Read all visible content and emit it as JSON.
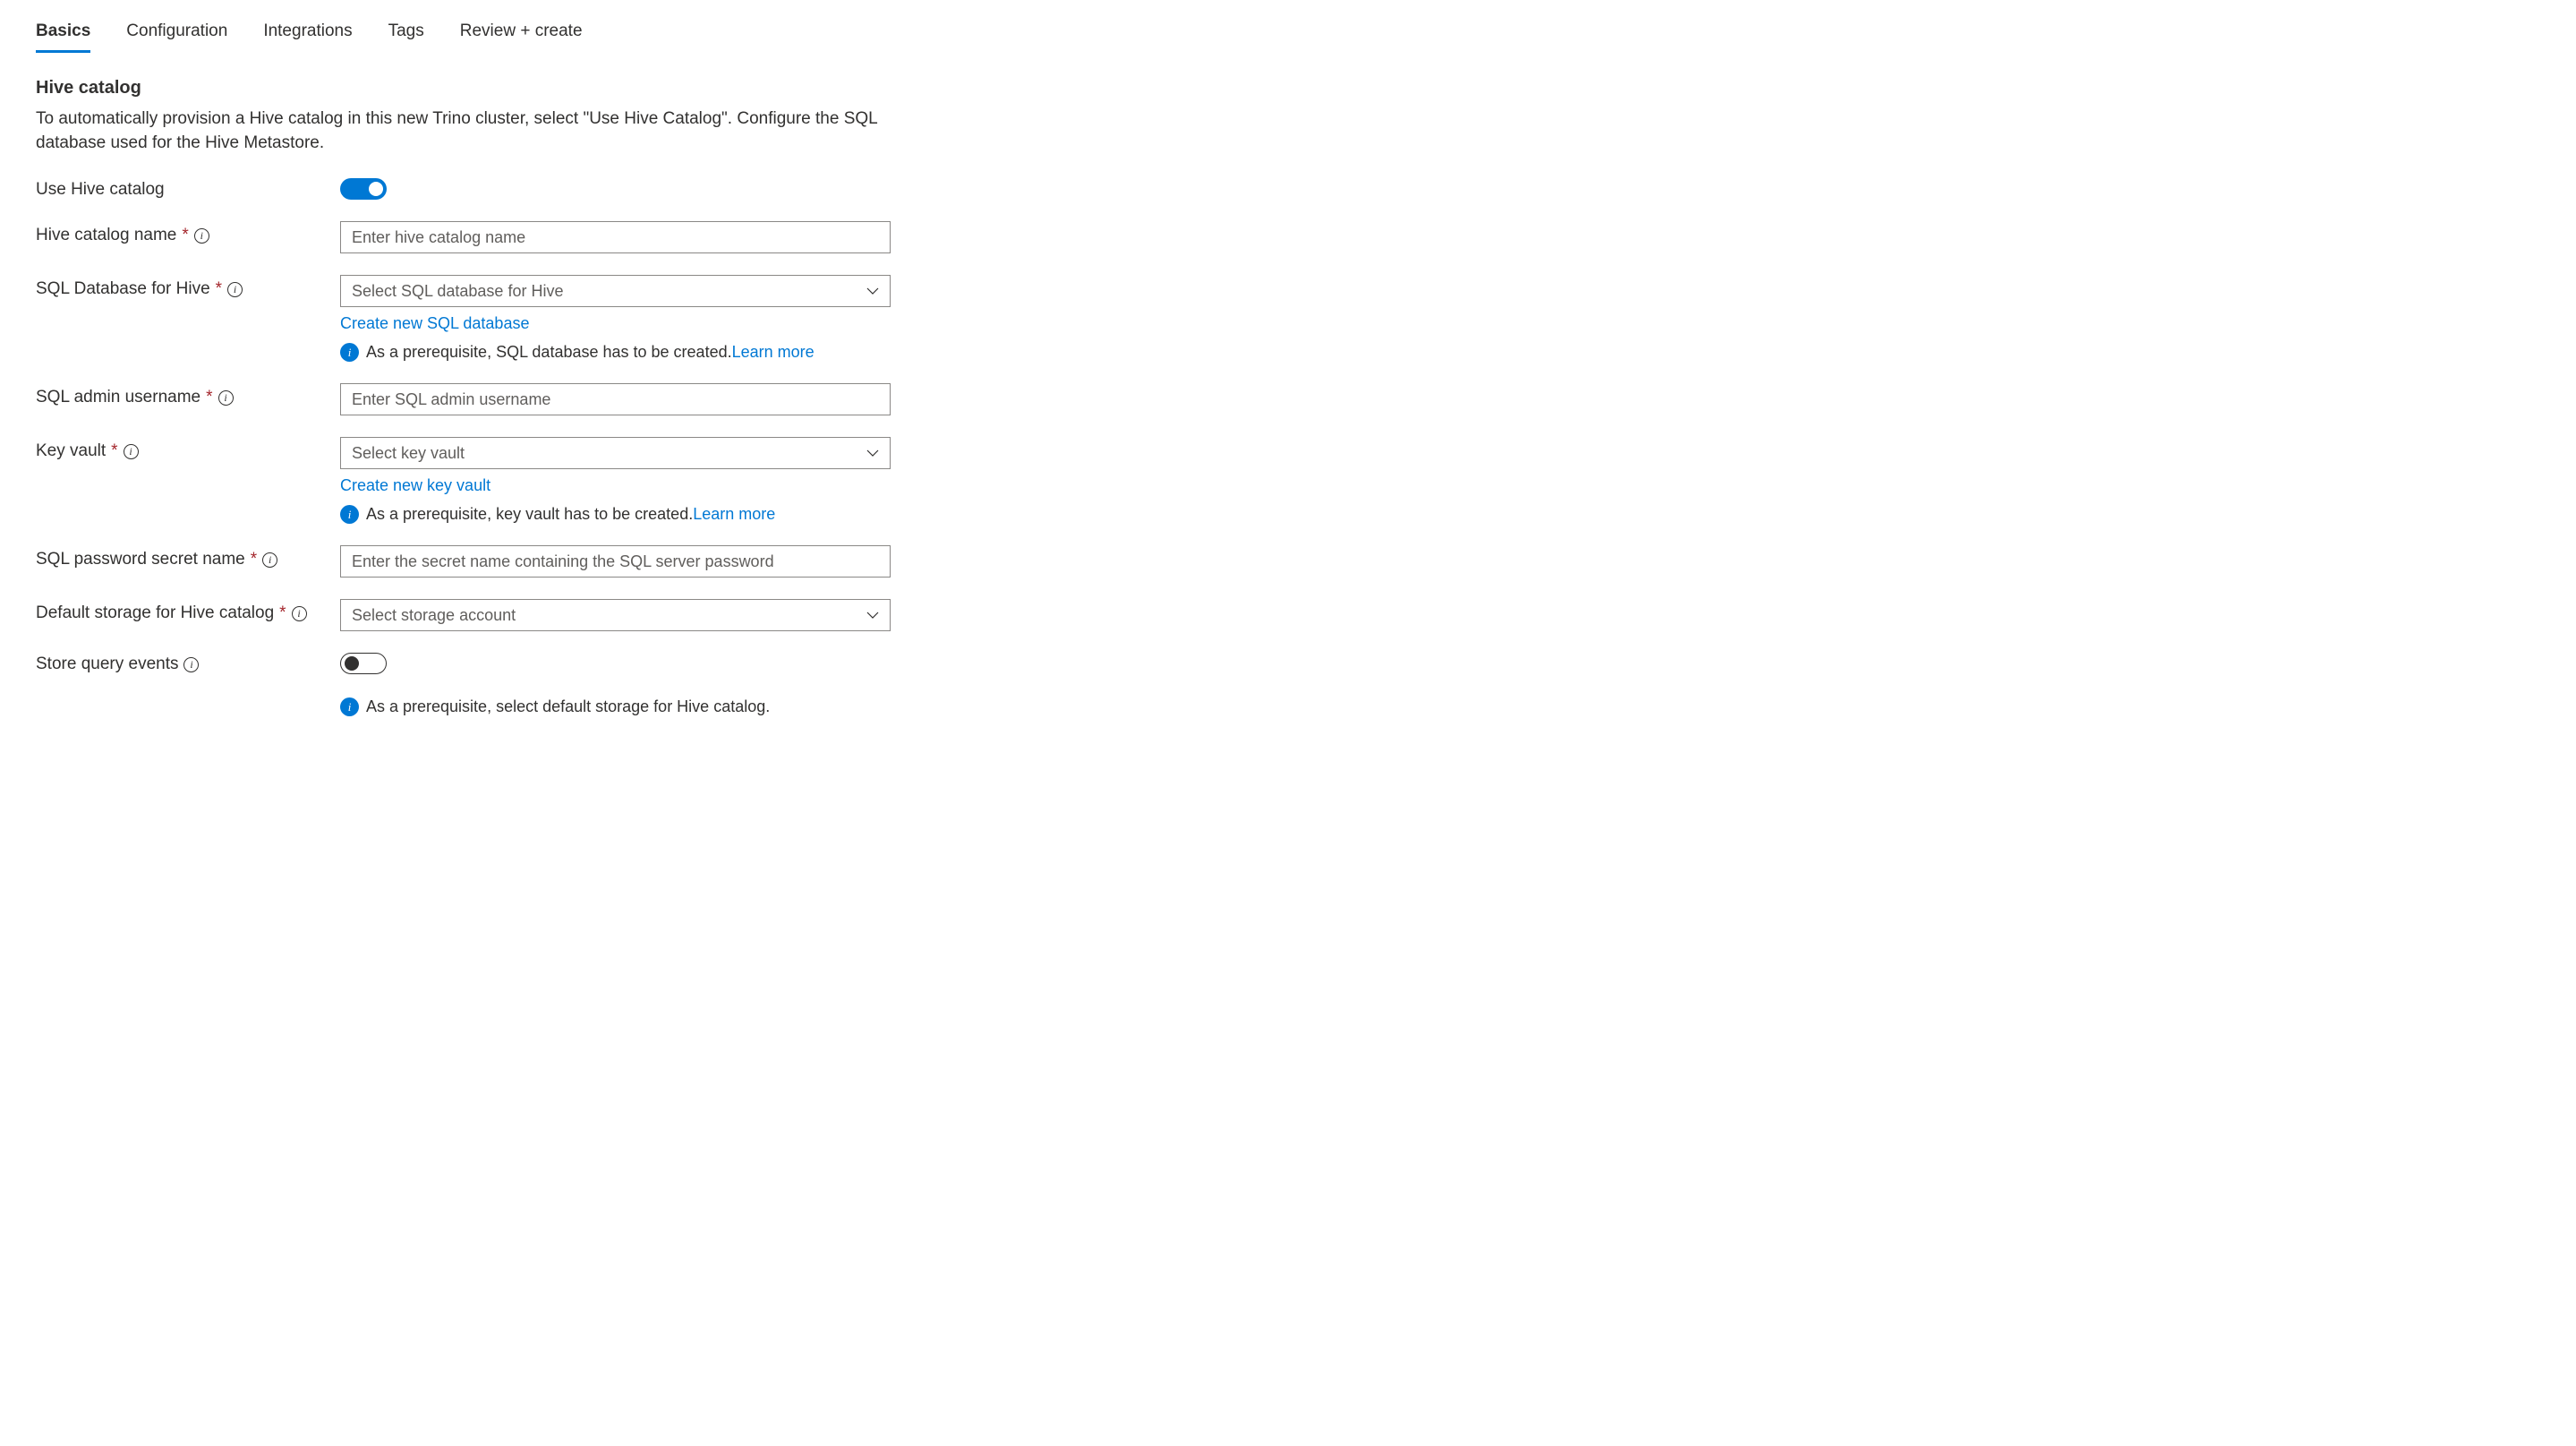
{
  "tabs": {
    "items": [
      "Basics",
      "Configuration",
      "Integrations",
      "Tags",
      "Review + create"
    ],
    "active_index": 0
  },
  "section": {
    "title": "Hive catalog",
    "description": "To automatically provision a Hive catalog in this new Trino cluster, select \"Use Hive Catalog\". Configure the SQL database used for the Hive Metastore."
  },
  "fields": {
    "use_hive_catalog": {
      "label": "Use Hive catalog",
      "value": true
    },
    "hive_catalog_name": {
      "label": "Hive catalog name",
      "placeholder": "Enter hive catalog name",
      "required": true
    },
    "sql_database": {
      "label": "SQL Database for Hive",
      "placeholder": "Select SQL database for Hive",
      "required": true,
      "create_link": "Create new SQL database",
      "info_text": "As a prerequisite, SQL database has to be created.",
      "learn_more": "Learn more"
    },
    "sql_admin_username": {
      "label": "SQL admin username",
      "placeholder": "Enter SQL admin username",
      "required": true
    },
    "key_vault": {
      "label": "Key vault",
      "placeholder": "Select key vault",
      "required": true,
      "create_link": "Create new key vault",
      "info_text": "As a prerequisite, key vault has to be created.",
      "learn_more": "Learn more"
    },
    "sql_password_secret": {
      "label": "SQL password secret name",
      "placeholder": "Enter the secret name containing the SQL server password",
      "required": true
    },
    "default_storage": {
      "label": "Default storage for Hive catalog",
      "placeholder": "Select storage account",
      "required": true
    },
    "store_query_events": {
      "label": "Store query events",
      "value": false,
      "info_text": "As a prerequisite, select default storage for Hive catalog."
    }
  }
}
